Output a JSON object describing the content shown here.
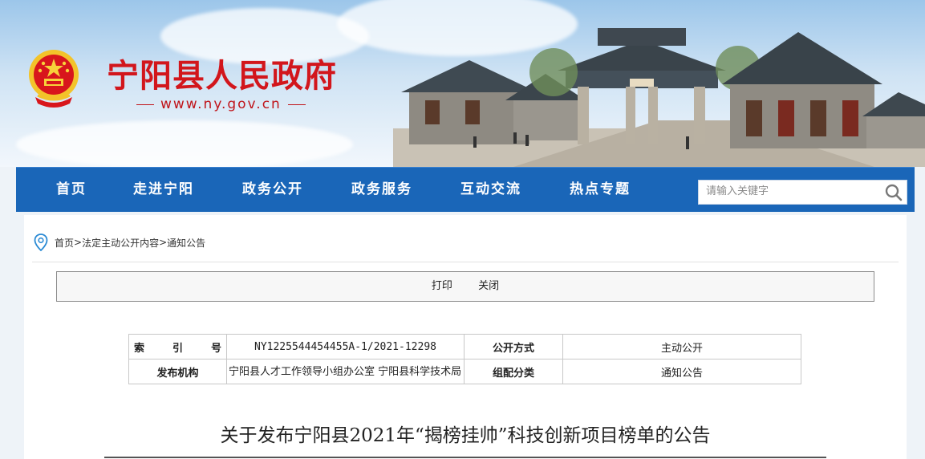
{
  "header": {
    "site_name": "宁阳县人民政府",
    "site_url": "www.ny.gov.cn",
    "colors": {
      "title_red": "#d2161c",
      "nav_blue": "#1a66b8"
    }
  },
  "nav": {
    "items": [
      {
        "label": "首页"
      },
      {
        "label": "走进宁阳"
      },
      {
        "label": "政务公开"
      },
      {
        "label": "政务服务"
      },
      {
        "label": "互动交流"
      },
      {
        "label": "热点专题"
      }
    ],
    "search": {
      "placeholder": "请输入关键字",
      "icon": "search-icon"
    }
  },
  "breadcrumb": {
    "icon": "location-pin-icon",
    "items": [
      "首页",
      "法定主动公开内容",
      "通知公告"
    ],
    "separator": ">"
  },
  "toolbar": {
    "print_label": "打印",
    "close_label": "关闭"
  },
  "meta": {
    "index_label": [
      "索",
      "引",
      "号"
    ],
    "index_value": "NY1225544454455A-1/2021-12298",
    "disclosure_label": "公开方式",
    "disclosure_value": "主动公开",
    "publisher_label": "发布机构",
    "publisher_value": "宁阳县人才工作领导小组办公室 宁阳县科学技术局",
    "category_label": "组配分类",
    "category_value": "通知公告"
  },
  "article": {
    "title": "关于发布宁阳县2021年“揭榜挂帅”科技创新项目榜单的公告"
  }
}
